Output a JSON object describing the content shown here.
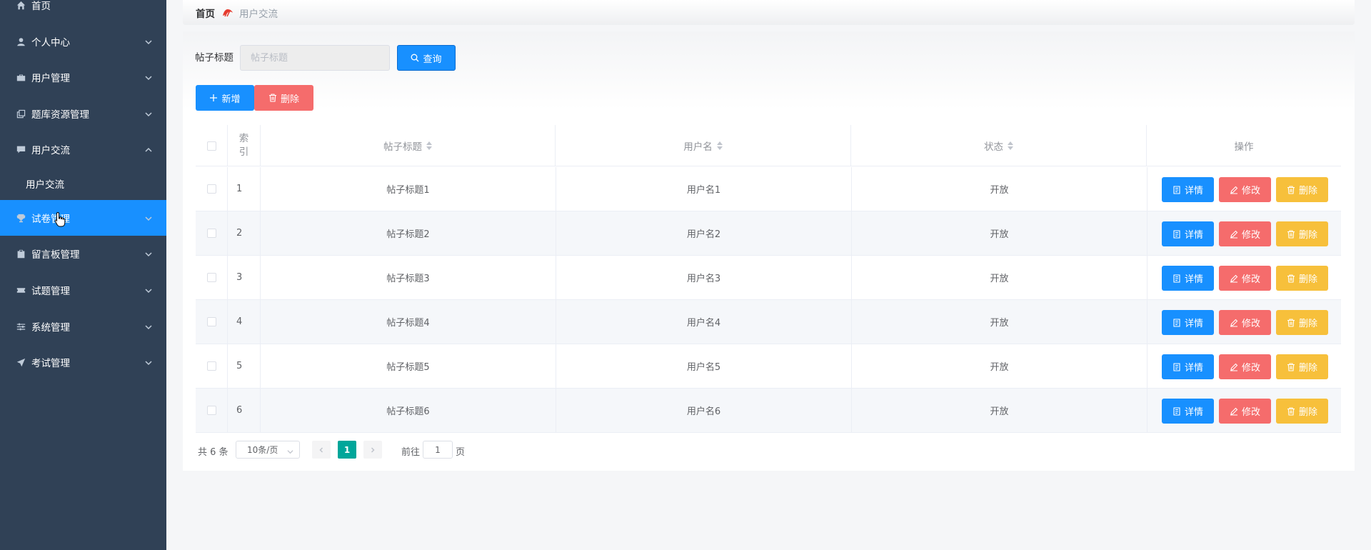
{
  "sidebar": {
    "items": [
      {
        "label": "首页",
        "icon": "home-icon"
      },
      {
        "label": "个人中心",
        "icon": "user-icon"
      },
      {
        "label": "用户管理",
        "icon": "briefcase-icon"
      },
      {
        "label": "题库资源管理",
        "icon": "copy-icon"
      },
      {
        "label": "用户交流",
        "icon": "chat-icon"
      },
      {
        "label": "用户交流",
        "icon": ""
      },
      {
        "label": "试卷管理",
        "icon": "trophy-icon"
      },
      {
        "label": "留言板管理",
        "icon": "clipboard-icon"
      },
      {
        "label": "试题管理",
        "icon": "ticket-icon"
      },
      {
        "label": "系统管理",
        "icon": "sliders-icon"
      },
      {
        "label": "考试管理",
        "icon": "send-icon"
      }
    ],
    "active_color": "#1890ff",
    "background": "#304156"
  },
  "breadcrumb": {
    "home": "首页",
    "current": "用户交流"
  },
  "search": {
    "label": "帖子标题",
    "placeholder": "帖子标题",
    "query_label": "查询"
  },
  "toolbar": {
    "add_label": "新增",
    "delete_label": "删除"
  },
  "table": {
    "headers": {
      "index": [
        "索",
        "引"
      ],
      "title": "帖子标题",
      "username": "用户名",
      "status": "状态",
      "actions": "操作"
    },
    "rows": [
      {
        "index": "1",
        "title": "帖子标题1",
        "username": "用户名1",
        "status": "开放"
      },
      {
        "index": "2",
        "title": "帖子标题2",
        "username": "用户名2",
        "status": "开放"
      },
      {
        "index": "3",
        "title": "帖子标题3",
        "username": "用户名3",
        "status": "开放"
      },
      {
        "index": "4",
        "title": "帖子标题4",
        "username": "用户名4",
        "status": "开放"
      },
      {
        "index": "5",
        "title": "帖子标题5",
        "username": "用户名5",
        "status": "开放"
      },
      {
        "index": "6",
        "title": "帖子标题6",
        "username": "用户名6",
        "status": "开放"
      }
    ],
    "action_labels": {
      "detail": "详情",
      "edit": "修改",
      "delete": "删除"
    }
  },
  "pagination": {
    "total": "共 6 条",
    "page_size": "10条/页",
    "current_page": "1",
    "goto_label": "前往",
    "goto_value": "1",
    "page_unit": "页"
  }
}
